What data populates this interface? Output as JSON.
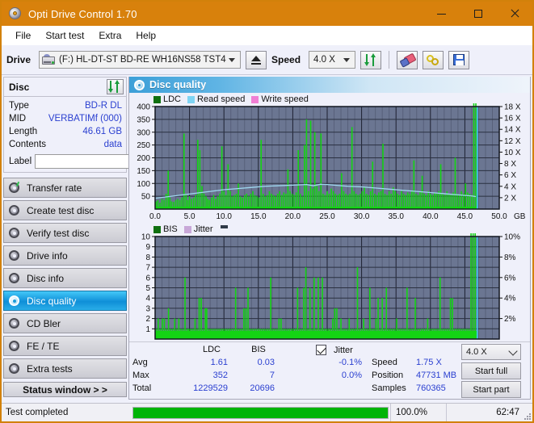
{
  "window": {
    "title": "Opti Drive Control 1.70",
    "icon": "disc-icon",
    "minimize": "—",
    "maximize": "□",
    "close": "✕"
  },
  "menu": {
    "items": [
      {
        "label": "File",
        "name": "menu-file"
      },
      {
        "label": "Start test",
        "name": "menu-start-test"
      },
      {
        "label": "Extra",
        "name": "menu-extra"
      },
      {
        "label": "Help",
        "name": "menu-help"
      }
    ]
  },
  "toolbar": {
    "drive_label": "Drive",
    "drive_value": "(F:)  HL-DT-ST BD-RE  WH16NS58 TST4",
    "eject_title": "eject",
    "speed_label": "Speed",
    "speed_value": "4.0 X",
    "refresh_icon": "refresh-icon",
    "erase_icon": "eraser-icon",
    "tools_icon": "tools-icon",
    "save_icon": "save-icon"
  },
  "disc": {
    "title": "Disc",
    "refresh_icon": "refresh-icon",
    "rows": [
      {
        "key": "Type",
        "value": "BD-R DL"
      },
      {
        "key": "MID",
        "value": "VERBATIMf (000)"
      },
      {
        "key": "Length",
        "value": "46.61 GB"
      },
      {
        "key": "Contents",
        "value": "data"
      }
    ],
    "label_key": "Label",
    "label_value": "",
    "label_placeholder": "",
    "label_button_icon": "disc-icon"
  },
  "sidebar": {
    "items": [
      {
        "label": "Transfer rate",
        "name": "sidebar-item-transfer-rate",
        "active": false
      },
      {
        "label": "Create test disc",
        "name": "sidebar-item-create-test-disc",
        "active": false
      },
      {
        "label": "Verify test disc",
        "name": "sidebar-item-verify-test-disc",
        "active": false
      },
      {
        "label": "Drive info",
        "name": "sidebar-item-drive-info",
        "active": false
      },
      {
        "label": "Disc info",
        "name": "sidebar-item-disc-info",
        "active": false
      },
      {
        "label": "Disc quality",
        "name": "sidebar-item-disc-quality",
        "active": true
      },
      {
        "label": "CD Bler",
        "name": "sidebar-item-cd-bler",
        "active": false
      },
      {
        "label": "FE / TE",
        "name": "sidebar-item-fe-te",
        "active": false
      },
      {
        "label": "Extra tests",
        "name": "sidebar-item-extra-tests",
        "active": false
      }
    ],
    "status_window_label": "Status window > >"
  },
  "main": {
    "panel_title": "Disc quality",
    "panel_icon": "disc-quality-icon"
  },
  "stats": {
    "col_ldc": "LDC",
    "col_bis": "BIS",
    "row_avg": "Avg",
    "row_max": "Max",
    "row_total": "Total",
    "avg_ldc": "1.61",
    "avg_bis": "0.03",
    "max_ldc": "352",
    "max_bis": "7",
    "total_ldc": "1229529",
    "total_bis": "20696",
    "jitter_label": "Jitter",
    "jitter_checked": true,
    "jitter_avg": "-0.1%",
    "jitter_max": "0.0%",
    "speed_label": "Speed",
    "speed_value": "1.75 X",
    "position_label": "Position",
    "position_value": "47731 MB",
    "samples_label": "Samples",
    "samples_value": "760365",
    "speed_select": "4.0 X",
    "start_full": "Start full",
    "start_part": "Start part"
  },
  "statusbar": {
    "message": "Test completed",
    "progress_percent": 100.0,
    "progress_text": "100.0%",
    "elapsed": "62:47"
  },
  "colors": {
    "title_bar": "#d8810c",
    "accent_blue": "#2a3fd0",
    "plot_bg": "#6b7692",
    "ldc_green": "#14d414",
    "bis_green": "#14d414",
    "read_speed": "#7fd4f4",
    "write_speed": "#f07fd4",
    "jitter": "#c8a8d8",
    "progress_green": "#00b407",
    "selected_nav": "#0f8fd8"
  },
  "chart_data": [
    {
      "type": "bar",
      "name": "ldc-chart",
      "title": "",
      "xlabel": "GB",
      "ylabel": "",
      "xlim": [
        0,
        50
      ],
      "ylim": [
        0,
        400
      ],
      "xticks": [
        "0.0",
        "5.0",
        "10.0",
        "15.0",
        "20.0",
        "25.0",
        "30.0",
        "35.0",
        "40.0",
        "45.0",
        "50.0"
      ],
      "yticks": [
        50,
        100,
        150,
        200,
        250,
        300,
        350,
        400
      ],
      "y2label": "X",
      "y2lim": [
        0,
        18
      ],
      "y2ticks": [
        "2 X",
        "4 X",
        "6 X",
        "8 X",
        "10 X",
        "12 X",
        "14 X",
        "16 X",
        "18 X"
      ],
      "grid": true,
      "legend": [
        {
          "label": "LDC",
          "color": "#107010"
        },
        {
          "label": "Read speed",
          "color": "#7fd4f4"
        },
        {
          "label": "Write speed",
          "color": "#f07fd4"
        }
      ],
      "series": [
        {
          "name": "LDC",
          "color": "#14d414",
          "type": "impulse",
          "x": [
            0.15,
            0.4,
            0.7,
            1.0,
            1.3,
            1.6,
            1.9,
            2.15,
            2.4,
            2.7,
            3.0,
            3.3,
            3.6,
            3.9,
            4.2,
            4.5,
            4.75,
            5.0,
            5.3,
            5.6,
            5.9,
            6.2,
            6.5,
            6.8,
            7.1,
            7.4,
            7.65,
            7.9,
            8.2,
            8.5,
            8.8,
            9.1,
            9.4,
            9.7,
            10.0,
            10.3,
            10.6,
            10.9,
            11.2,
            11.5,
            11.8,
            12.1,
            12.4,
            12.7,
            13.0,
            13.3,
            13.6,
            13.9,
            14.2,
            14.5,
            14.8,
            15.1,
            15.4,
            15.7,
            16.0,
            16.3,
            16.6,
            16.9,
            17.2,
            17.5,
            17.8,
            18.1,
            18.4,
            18.7,
            19.0,
            19.3,
            19.6,
            19.9,
            20.2,
            20.5,
            20.8,
            21.1,
            21.4,
            21.7,
            22.0,
            22.3,
            22.6,
            22.9,
            23.2,
            23.5,
            23.8,
            24.1,
            24.4,
            24.7,
            25.0,
            25.3,
            25.6,
            25.9,
            26.2,
            26.5,
            26.8,
            27.1,
            27.4,
            27.7,
            28.0,
            28.3,
            28.6,
            28.9,
            29.2,
            29.5,
            29.8,
            30.1,
            30.4,
            30.7,
            31.0,
            31.3,
            31.6,
            31.9,
            32.2,
            32.5,
            32.8,
            33.1,
            33.4,
            33.7,
            34.0,
            34.3,
            34.6,
            34.9,
            35.2,
            35.5,
            35.8,
            36.1,
            36.4,
            36.7,
            37.0,
            37.3,
            37.6,
            37.9,
            38.2,
            38.5,
            38.8,
            39.1,
            39.4,
            39.7,
            40.0,
            40.3,
            40.6,
            40.9,
            41.2,
            41.5,
            41.8,
            42.1,
            42.4,
            42.7,
            43.0,
            43.3,
            43.6,
            43.9,
            44.2,
            44.5,
            44.8,
            45.1,
            45.4,
            45.7,
            46.0,
            46.3,
            46.6
          ],
          "values": [
            30,
            35,
            25,
            40,
            35,
            60,
            150,
            45,
            30,
            28,
            35,
            40,
            35,
            45,
            295,
            60,
            35,
            50,
            40,
            45,
            55,
            270,
            230,
            90,
            60,
            50,
            40,
            35,
            45,
            55,
            40,
            50,
            60,
            245,
            70,
            55,
            175,
            70,
            50,
            55,
            60,
            100,
            50,
            45,
            55,
            60,
            50,
            60,
            70,
            55,
            50,
            45,
            270,
            60,
            50,
            55,
            70,
            60,
            55,
            50,
            60,
            70,
            55,
            65,
            60,
            155,
            70,
            60,
            55,
            65,
            230,
            60,
            50,
            250,
            350,
            70,
            345,
            80,
            300,
            90,
            70,
            295,
            60,
            55,
            70,
            60,
            80,
            70,
            60,
            55,
            60,
            140,
            70,
            60,
            55,
            60,
            320,
            70,
            60,
            55,
            60,
            70,
            85,
            60,
            55,
            70,
            185,
            60,
            55,
            65,
            70,
            255,
            60,
            55,
            70,
            60,
            85,
            70,
            60,
            55,
            70,
            60,
            55,
            65,
            60,
            70,
            190,
            60,
            55,
            70,
            130,
            60,
            55,
            70,
            60,
            55,
            65,
            60,
            70,
            175,
            60,
            55,
            70,
            60,
            55,
            65,
            200,
            60,
            55,
            70,
            60,
            100,
            65,
            60,
            55
          ]
        },
        {
          "name": "Read speed",
          "color": "#9fd8f0",
          "type": "line",
          "x": [
            0.0,
            2.0,
            4.0,
            6.0,
            8.0,
            10.0,
            12.0,
            14.0,
            16.0,
            18.0,
            20.0,
            22.0,
            23.0,
            24.0,
            25.0,
            26.0,
            28.0,
            30.0,
            32.0,
            34.0,
            36.0,
            38.0,
            40.0,
            42.0,
            44.0,
            46.0,
            46.6
          ],
          "values_x": [
            1.9,
            2.2,
            2.5,
            2.8,
            3.1,
            3.4,
            3.6,
            3.8,
            4.0,
            4.1,
            4.2,
            4.3,
            4.1,
            4.35,
            4.3,
            4.2,
            4.0,
            3.9,
            3.7,
            3.5,
            3.3,
            3.1,
            2.9,
            2.7,
            2.5,
            2.3,
            2.2
          ]
        },
        {
          "name": "cursor",
          "color": "#40c8f0",
          "type": "vline",
          "x": 46.8
        }
      ]
    },
    {
      "type": "bar",
      "name": "bis-chart",
      "title": "",
      "xlabel": "GB",
      "ylabel": "",
      "xlim": [
        0,
        50
      ],
      "ylim": [
        0,
        10
      ],
      "xticks": [
        "0.0",
        "5.0",
        "10.0",
        "15.0",
        "20.0",
        "25.0",
        "30.0",
        "35.0",
        "40.0",
        "45.0",
        "50.0"
      ],
      "yticks": [
        1,
        2,
        3,
        4,
        5,
        6,
        7,
        8,
        9,
        10
      ],
      "y2label": "%",
      "y2lim": [
        0,
        10
      ],
      "y2ticks": [
        "2%",
        "4%",
        "6%",
        "8%",
        "10%"
      ],
      "grid": true,
      "legend": [
        {
          "label": "BIS",
          "color": "#107010"
        },
        {
          "label": "Jitter",
          "color": "#c8a8d8"
        }
      ],
      "series": [
        {
          "name": "BIS",
          "color": "#14d414",
          "type": "impulse",
          "x": [
            0.15,
            0.45,
            0.75,
            1.05,
            1.35,
            1.65,
            1.95,
            2.25,
            2.55,
            2.85,
            3.15,
            3.45,
            3.75,
            4.05,
            4.35,
            4.65,
            4.9,
            5.2,
            5.5,
            5.8,
            6.1,
            6.4,
            6.7,
            7.0,
            7.3,
            7.5,
            7.8,
            8.1,
            8.4,
            8.7,
            9.0,
            9.3,
            9.6,
            9.9,
            10.2,
            10.5,
            10.8,
            11.1,
            11.4,
            11.7,
            12.0,
            12.3,
            12.6,
            12.9,
            13.2,
            13.5,
            13.8,
            14.1,
            14.4,
            14.7,
            15.0,
            15.3,
            15.6,
            15.9,
            16.2,
            16.5,
            16.8,
            17.1,
            17.4,
            17.7,
            18.0,
            18.3,
            18.6,
            18.9,
            19.2,
            19.5,
            19.8,
            20.1,
            20.4,
            20.7,
            21.0,
            21.3,
            21.6,
            21.9,
            22.2,
            22.5,
            22.8,
            23.1,
            23.4,
            23.7,
            24.0,
            24.3,
            24.6,
            24.9,
            25.2,
            25.5,
            25.8,
            26.1,
            26.4,
            26.7,
            27.0,
            27.3,
            27.6,
            27.9,
            28.2,
            28.5,
            28.8,
            29.1,
            29.4,
            29.7,
            30.0,
            30.3,
            30.6,
            30.9,
            31.2,
            31.5,
            31.8,
            32.1,
            32.4,
            32.7,
            33.0,
            33.3,
            33.6,
            33.9,
            34.2,
            34.5,
            34.8,
            35.1,
            35.4,
            35.7,
            36.0,
            36.3,
            36.6,
            36.9,
            37.2,
            37.5,
            37.8,
            38.1,
            38.4,
            38.7,
            39.0,
            39.3,
            39.6,
            39.9,
            40.2,
            40.5,
            40.8,
            41.1,
            41.4,
            41.7,
            42.0,
            42.3,
            42.6,
            42.9,
            43.2,
            43.5,
            43.8,
            44.1,
            44.4,
            44.7,
            45.0,
            45.3,
            45.6,
            45.9,
            46.2,
            46.5
          ],
          "values": [
            1,
            2,
            1,
            2,
            2,
            1,
            3,
            1,
            1,
            2,
            1,
            2,
            1,
            1,
            6,
            1,
            1,
            1,
            1,
            2,
            1,
            4,
            4,
            1,
            3,
            3,
            1,
            1,
            1,
            1,
            1,
            1,
            1,
            1,
            1,
            1,
            1,
            1,
            1,
            5,
            1,
            1,
            1,
            3,
            3,
            5,
            1,
            1,
            1,
            1,
            1,
            1,
            1,
            1,
            1,
            1,
            6,
            1,
            1,
            1,
            2,
            2,
            1,
            1,
            1,
            1,
            1,
            1,
            1,
            5,
            1,
            1,
            5,
            7,
            1,
            5,
            1,
            6,
            1,
            6,
            1,
            6,
            1,
            1,
            1,
            1,
            2,
            3,
            3,
            1,
            2,
            1,
            1,
            1,
            2,
            1,
            1,
            1,
            7,
            1,
            1,
            2,
            1,
            1,
            5,
            1,
            1,
            2,
            4,
            1,
            4,
            1,
            5,
            1,
            1,
            1,
            1,
            2,
            1,
            1,
            1,
            1,
            5,
            1,
            1,
            1,
            4,
            1,
            1,
            1,
            1,
            1,
            2,
            1,
            1,
            1,
            1,
            1,
            6,
            1,
            1,
            1,
            1,
            4,
            4,
            1,
            1,
            1,
            1,
            1,
            1,
            1,
            1
          ]
        },
        {
          "name": "cursor",
          "color": "#40c8f0",
          "type": "vline",
          "x": 46.8
        }
      ]
    }
  ]
}
